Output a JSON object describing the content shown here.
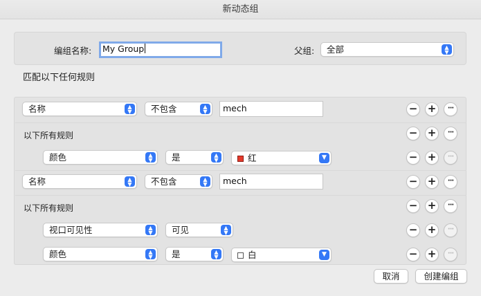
{
  "window": {
    "title": "新动态组"
  },
  "header": {
    "name_label": "编组名称:",
    "name_value": "My Group",
    "parent_label": "父组:",
    "parent_value": "全部"
  },
  "rules_title": "匹配以下任何规则",
  "rules": {
    "r1": {
      "field": "名称",
      "op": "不包含",
      "value": "mech"
    },
    "g1": {
      "label": "以下所有规则",
      "c1": {
        "field": "颜色",
        "op": "是",
        "value": "红",
        "swatch": "#e53b2c"
      }
    },
    "r2": {
      "field": "名称",
      "op": "不包含",
      "value": "mech"
    },
    "g2": {
      "label": "以下所有规则",
      "c1": {
        "field": "视口可见性",
        "op": "可见"
      },
      "c2": {
        "field": "颜色",
        "op": "是",
        "value": "白",
        "swatch": "#ffffff"
      }
    }
  },
  "buttons": {
    "cancel": "取消",
    "create": "创建编组"
  },
  "colors": {
    "accent": "#3478f6",
    "focus_ring": "#7fa9e9"
  }
}
